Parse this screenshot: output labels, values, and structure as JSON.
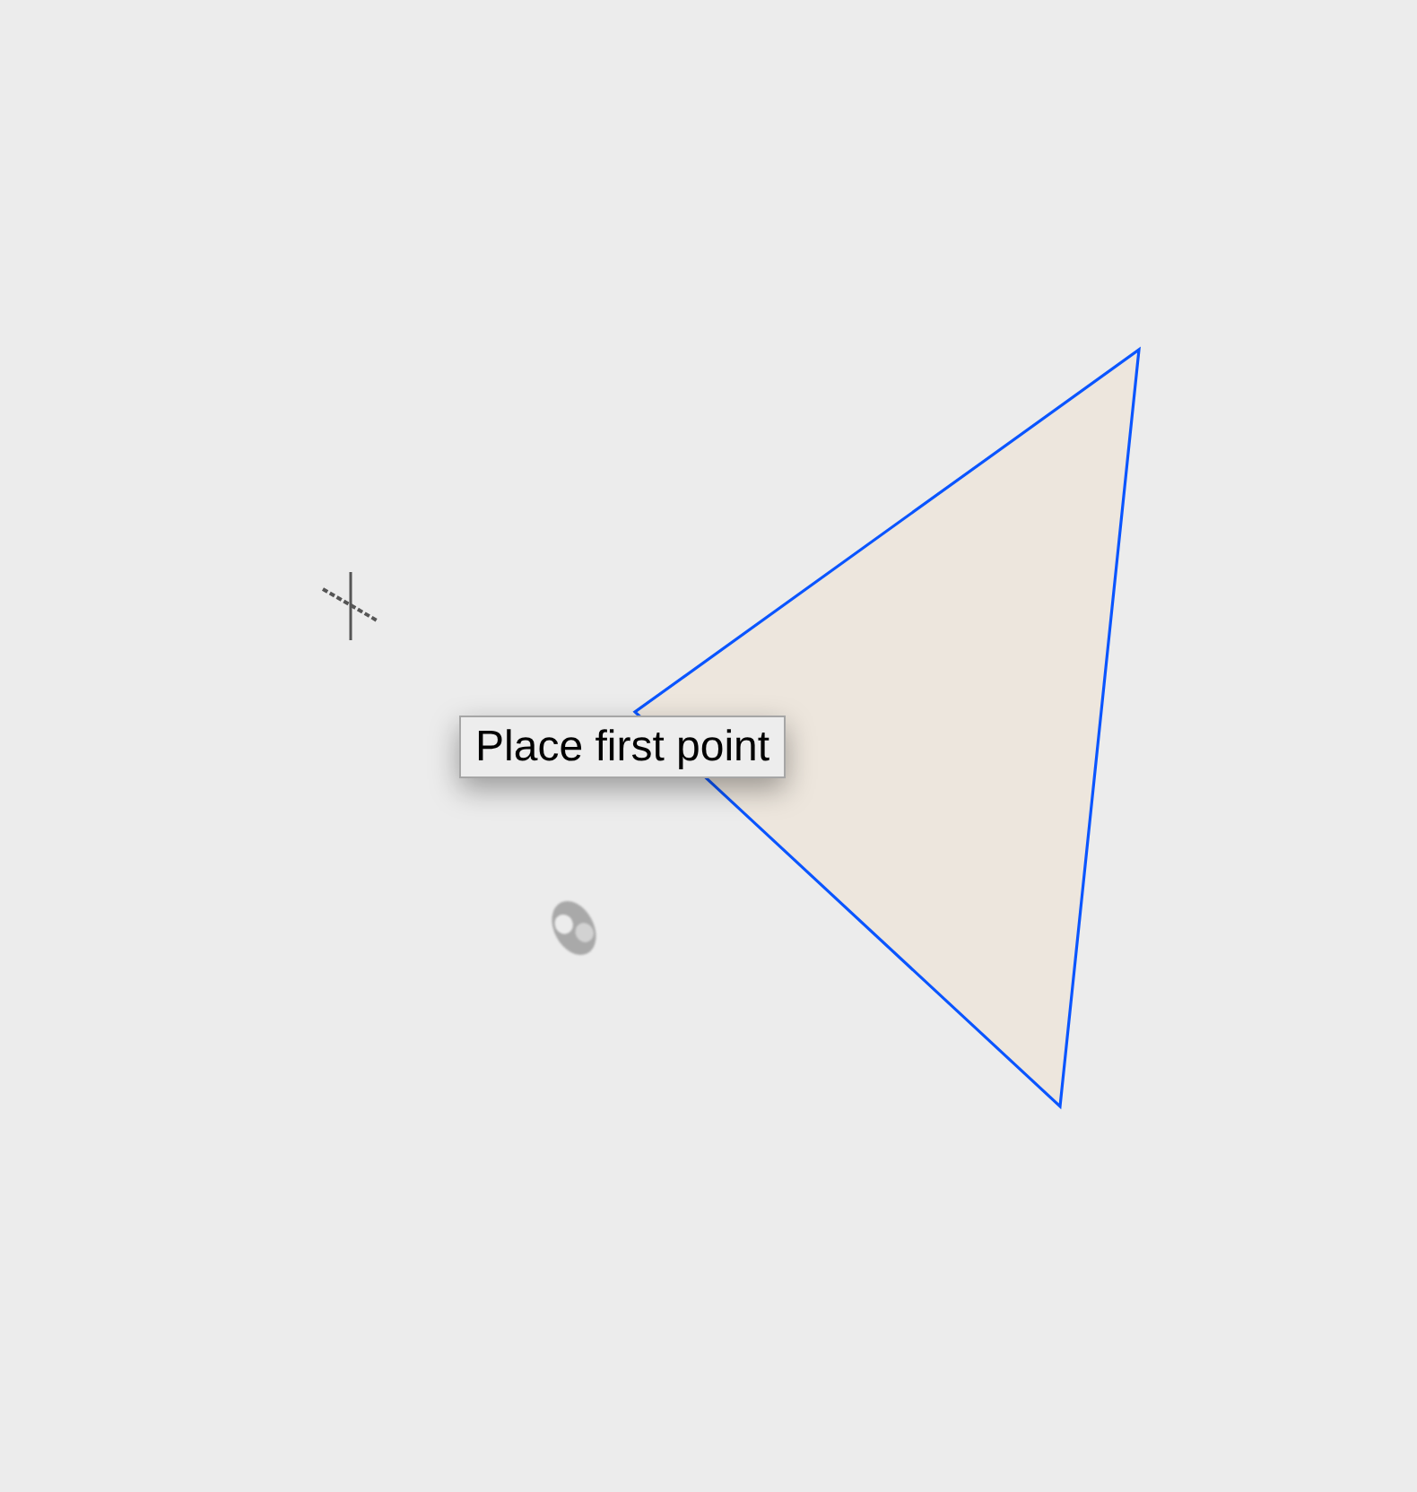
{
  "tooltip": {
    "text": "Place first point"
  }
}
